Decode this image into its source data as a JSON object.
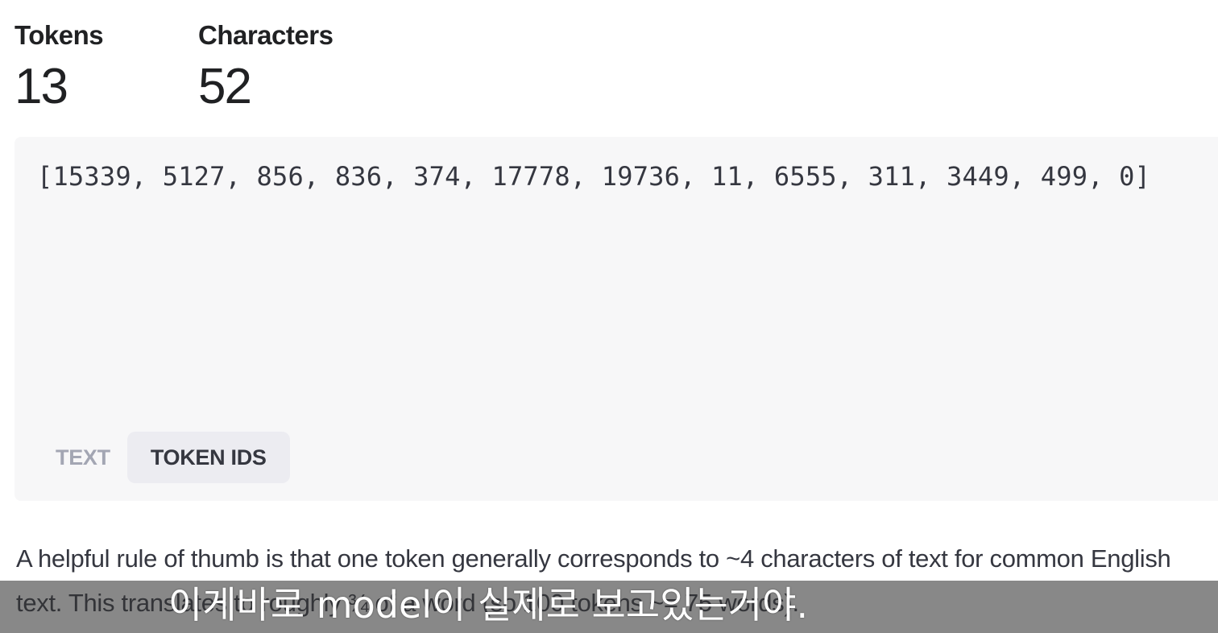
{
  "stats": {
    "tokens_label": "Tokens",
    "tokens_value": "13",
    "characters_label": "Characters",
    "characters_value": "52"
  },
  "output": {
    "token_ids": "[15339, 5127, 856, 836, 374, 17778, 19736, 11, 6555, 311, 3449, 499, 0]"
  },
  "tabs": [
    {
      "label": "TEXT",
      "active": false
    },
    {
      "label": "TOKEN IDS",
      "active": true
    }
  ],
  "description": "A helpful rule of thumb is that one token generally corresponds to ~4 characters of text for common English text. This translates to roughly ¾ of a word (so 100 tokens ~= 75 words).",
  "subtitle": "이게바로 model이 실제로 보고있는거야.",
  "colors": {
    "panel_bg": "#f7f7f8",
    "active_tab_bg": "#ececf1",
    "inactive_tab_text": "#a3a6b3",
    "text": "#202123"
  }
}
